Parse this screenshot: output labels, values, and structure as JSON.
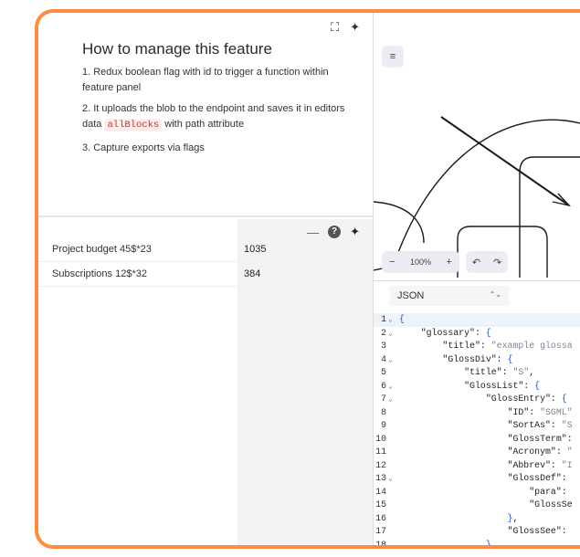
{
  "doc": {
    "title": "How to manage this feature",
    "items": [
      {
        "text": "1. Redux boolean flag with id to trigger a function within feature panel"
      },
      {
        "before": "2. It uploads the blob to the endpoint and saves it in editors data ",
        "code": "allBlocks",
        "after": " with path attribute"
      },
      {
        "text": "3. Capture exports via flags"
      }
    ],
    "tools": {
      "fullscreen": "⛶",
      "ai": "✦"
    }
  },
  "table": {
    "rows": [
      {
        "label": "Project budget 45$*23",
        "value": "1035"
      },
      {
        "label": "Subscriptions 12$*32",
        "value": "384"
      }
    ],
    "tools": {
      "minimize": "—",
      "help": "?",
      "ai": "✦"
    }
  },
  "canvas": {
    "menu": "≡",
    "zoom": "100%",
    "zoom_out": "−",
    "zoom_in": "+",
    "undo": "↶",
    "redo": "↷"
  },
  "editor": {
    "language": "JSON",
    "selector": "⌃⌄",
    "lines": [
      [
        "1",
        true,
        [
          [
            "b",
            "{"
          ]
        ]
      ],
      [
        "2",
        true,
        [
          [
            "k",
            "    \"glossary\": "
          ],
          [
            "b",
            "{"
          ]
        ]
      ],
      [
        "3",
        false,
        [
          [
            "k",
            "        \"title\": "
          ],
          [
            "s",
            "\"example glossa"
          ]
        ]
      ],
      [
        "4",
        true,
        [
          [
            "k",
            "        \"GlossDiv\": "
          ],
          [
            "b",
            "{"
          ]
        ]
      ],
      [
        "5",
        false,
        [
          [
            "k",
            "            \"title\": "
          ],
          [
            "s",
            "\"S\""
          ],
          [
            "k",
            ","
          ]
        ]
      ],
      [
        "6",
        true,
        [
          [
            "k",
            "            \"GlossList\": "
          ],
          [
            "b",
            "{"
          ]
        ]
      ],
      [
        "7",
        true,
        [
          [
            "k",
            "                \"GlossEntry\": "
          ],
          [
            "b",
            "{"
          ]
        ]
      ],
      [
        "8",
        false,
        [
          [
            "k",
            "                    \"ID\": "
          ],
          [
            "s",
            "\"SGML\""
          ]
        ]
      ],
      [
        "9",
        false,
        [
          [
            "k",
            "                    \"SortAs\": "
          ],
          [
            "s",
            "\"S"
          ]
        ]
      ],
      [
        "10",
        false,
        [
          [
            "k",
            "                    \"GlossTerm\":"
          ]
        ]
      ],
      [
        "11",
        false,
        [
          [
            "k",
            "                    \"Acronym\": "
          ],
          [
            "s",
            "\""
          ]
        ]
      ],
      [
        "12",
        false,
        [
          [
            "k",
            "                    \"Abbrev\": "
          ],
          [
            "s",
            "\"I"
          ]
        ]
      ],
      [
        "13",
        true,
        [
          [
            "k",
            "                    \"GlossDef\": "
          ]
        ]
      ],
      [
        "14",
        false,
        [
          [
            "k",
            "                        \"para\": "
          ]
        ]
      ],
      [
        "15",
        false,
        [
          [
            "k",
            "                        \"GlossSe"
          ]
        ]
      ],
      [
        "16",
        false,
        [
          [
            "b",
            "                    }"
          ],
          [
            "k",
            ","
          ]
        ]
      ],
      [
        "17",
        false,
        [
          [
            "k",
            "                    \"GlossSee\": "
          ]
        ]
      ],
      [
        "18",
        false,
        [
          [
            "b",
            "                }"
          ]
        ]
      ]
    ]
  },
  "colors": {
    "frame": "#ff8c42",
    "brace": "#1a56db",
    "string": "#7d8590",
    "code_inline": "#c0392b"
  }
}
